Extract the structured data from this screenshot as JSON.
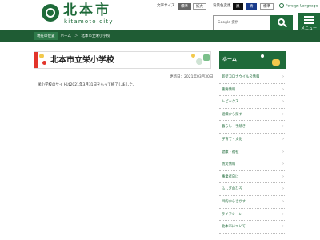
{
  "header": {
    "logo_text": "北本市",
    "logo_sub": "kitamoto city",
    "font_size_label": "文字サイズ",
    "font_size_standard": "標準",
    "font_size_large": "拡大",
    "bg_color_label": "背景色変更",
    "bg_black": "黒",
    "bg_blue": "青",
    "bg_standard": "標準",
    "foreign_language": "Foreign Language",
    "search_placeholder": "Google 提供",
    "menu_label": "メニュー"
  },
  "breadcrumb": {
    "location_label": "現在の位置",
    "home": "ホーム",
    "separator": "＞",
    "current": "北本市立栄小学校"
  },
  "main": {
    "title": "北本市立栄小学校",
    "updated": "更新日：2021年03月30日",
    "body": "栄小学校のサイトは2021年3月31日をもって終了しました。"
  },
  "sidebar": {
    "home_label": "ホーム",
    "items": [
      {
        "label": "新型コロナウイルス情報"
      },
      {
        "label": "重要情報"
      },
      {
        "label": "トピックス"
      },
      {
        "label": "組織から探す"
      },
      {
        "label": "暮らし・手続き"
      },
      {
        "label": "子育て・文化"
      },
      {
        "label": "健康・福祉"
      },
      {
        "label": "防災情報"
      },
      {
        "label": "事業者向け"
      },
      {
        "label": "ふしぎのひろ"
      },
      {
        "label": "目的からさがす"
      },
      {
        "label": "ライフシーン"
      },
      {
        "label": "北本市について"
      }
    ]
  },
  "colors": {
    "brand_green": "#1f6b3a",
    "accent_red": "#e2342a"
  }
}
